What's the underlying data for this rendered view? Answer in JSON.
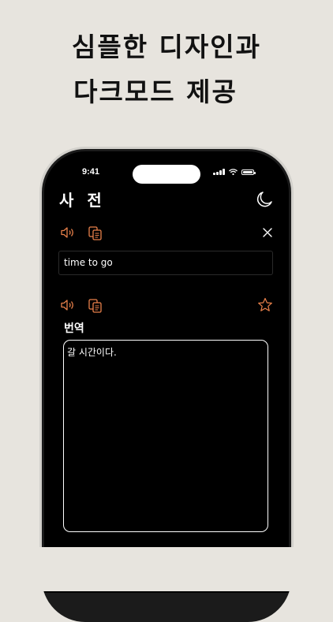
{
  "promo": {
    "line1": "심플한 디자인과",
    "line2": "다크모드 제공"
  },
  "status_bar": {
    "time": "9:41"
  },
  "app": {
    "title": "사 전",
    "input_text": "time to go",
    "translation_label": "번역",
    "translation_text": "갈 시간이다."
  },
  "colors": {
    "accent": "#e8804a",
    "background": "#e7e4de",
    "screen": "#000000",
    "text": "#ffffff"
  },
  "icons": {
    "theme_toggle": "moon-icon",
    "speak": "speaker-icon",
    "copy": "copy-icon",
    "clear": "close-icon",
    "favorite": "star-icon"
  }
}
